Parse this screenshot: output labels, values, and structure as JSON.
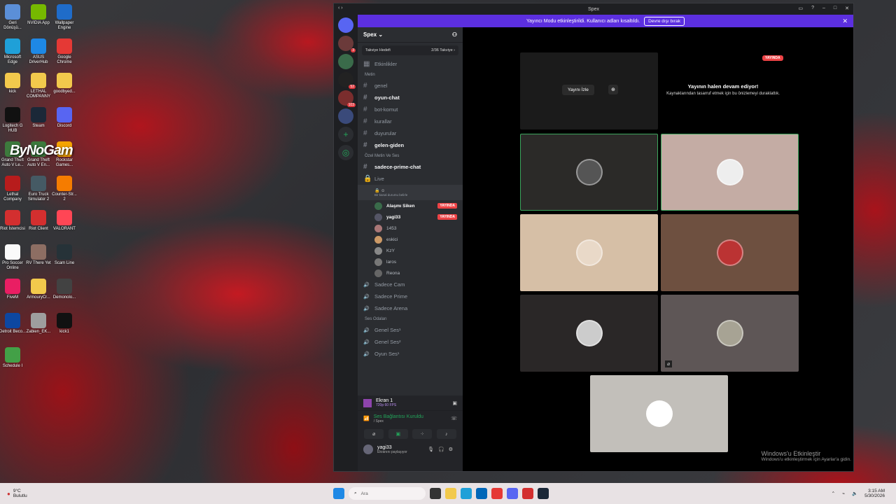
{
  "desktop": {
    "icons": [
      {
        "label": "Geri Dönüşü...",
        "color": "#5b8fd8"
      },
      {
        "label": "NVIDIA App",
        "color": "#76b900"
      },
      {
        "label": "Wallpaper Engine",
        "color": "#1f6cc9"
      },
      {
        "label": "Microsoft Edge",
        "color": "#1fa0d8"
      },
      {
        "label": "ASUS DriverHub",
        "color": "#1e88e5"
      },
      {
        "label": "Google Chrome",
        "color": "#e53935"
      },
      {
        "label": "kick",
        "color": "#f2c94c"
      },
      {
        "label": "LETHAL COMPANNY",
        "color": "#f2c94c"
      },
      {
        "label": "goodbyed...",
        "color": "#f2c94c"
      },
      {
        "label": "Logitech G HUB",
        "color": "#111111"
      },
      {
        "label": "Steam",
        "color": "#1b2838"
      },
      {
        "label": "Discord",
        "color": "#5865f2"
      },
      {
        "label": "Grand Theft Auto V Le...",
        "color": "#3d7a3d"
      },
      {
        "label": "Grand Theft Auto V En...",
        "color": "#3d7a3d"
      },
      {
        "label": "Rockstar Games...",
        "color": "#f4a300"
      },
      {
        "label": "Lethal Company",
        "color": "#b71c1c"
      },
      {
        "label": "Euro Truck Simulator 2",
        "color": "#455a64"
      },
      {
        "label": "Counter-Str... 2",
        "color": "#f57c00"
      },
      {
        "label": "Riot İstemcisi",
        "color": "#d32f2f"
      },
      {
        "label": "Riot Client",
        "color": "#d32f2f"
      },
      {
        "label": "VALORANT",
        "color": "#ff4655"
      },
      {
        "label": "Pro Soccer Online",
        "color": "#fafafa"
      },
      {
        "label": "RV There Yet",
        "color": "#8d6e63"
      },
      {
        "label": "Scam Line",
        "color": "#263238"
      },
      {
        "label": "FiveM",
        "color": "#e91e63"
      },
      {
        "label": "ArmouryCr...",
        "color": "#f2c94c"
      },
      {
        "label": "Demonolo...",
        "color": "#424242"
      },
      {
        "label": "Detroit Beco...",
        "color": "#0d47a1"
      },
      {
        "label": "Zabien_EK...",
        "color": "#9e9e9e"
      },
      {
        "label": "kick1",
        "color": "#111111"
      },
      {
        "label": "Schedule I",
        "color": "#43a047"
      }
    ],
    "watermark": "ByNoGam"
  },
  "window": {
    "title": "Spex",
    "banner_text": "Yayıncı Modu etkinleştirildi. Kullanıcı adları kısaltıldı.",
    "banner_button": "Devre dışı bırak"
  },
  "servers": [
    {
      "badge": "3"
    },
    {
      "badge": ""
    },
    {
      "badge": "52"
    },
    {
      "badge": "103"
    },
    {
      "badge": ""
    }
  ],
  "channels": {
    "server_name": "Spex ⌄",
    "boost_label": "Takviye Hedefi",
    "boost_value": "2/36 Takviye ›",
    "events": "Etkinlikler",
    "category1": "Metin",
    "text_channels": [
      {
        "name": "genel",
        "bold": false
      },
      {
        "name": "oyun-chat",
        "bold": true
      },
      {
        "name": "bot-komut",
        "bold": false
      },
      {
        "name": "kurallar",
        "bold": false
      },
      {
        "name": "duyurular",
        "bold": false
      },
      {
        "name": "gelen-giden",
        "bold": true
      }
    ],
    "category2": "Özel Metin Ve Ses",
    "private_channel": "sadece-prime-chat",
    "live_channel": "Live",
    "voice_status": "Bir kanal durumu belirle",
    "voice_users": [
      {
        "name": "Alaşmı Siken",
        "live": true,
        "strong": true
      },
      {
        "name": "yagi33",
        "live": true,
        "strong": true
      },
      {
        "name": "1453",
        "live": false,
        "strong": false
      },
      {
        "name": "eskici",
        "live": false,
        "strong": false
      },
      {
        "name": "KzY",
        "live": false,
        "strong": false
      },
      {
        "name": "laros",
        "live": false,
        "strong": false
      },
      {
        "name": "Reona",
        "live": false,
        "strong": false
      }
    ],
    "live_badge": "YAYINDA",
    "voice_channels_a": [
      "Sadece Cam",
      "Sadece Prime",
      "Sadece Arena"
    ],
    "category3": "Ses Odaları",
    "voice_channels_b": [
      "Genel Ses¹",
      "Genel Ses²",
      "Oyun Ses¹"
    ]
  },
  "voice_panel": {
    "screen_title": "Ekran 1",
    "screen_quality": "720p 60 FPS",
    "connection": "Ses Bağlantısı Kuruldu",
    "connection_sub": "/ Spex",
    "username": "yagi33",
    "user_status": "Ekranını paylaşıyor"
  },
  "stage": {
    "watch_button": "Yayını İzle",
    "paused_title": "Yayının halen devam ediyor!",
    "paused_sub": "Kaynaklarından tasarruf etmek için bu önizlemeyi duraklattık.",
    "live_tag": "YAYINDA"
  },
  "activation": {
    "title": "Windows'u Etkinleştir",
    "sub": "Windows'u etkinleştirmek için Ayarlar'a gidin."
  },
  "taskbar": {
    "weather_temp": "9°C",
    "weather_text": "Bulutlu",
    "search_placeholder": "Ara",
    "time": "3:15 AM",
    "date": "5/30/2026"
  }
}
